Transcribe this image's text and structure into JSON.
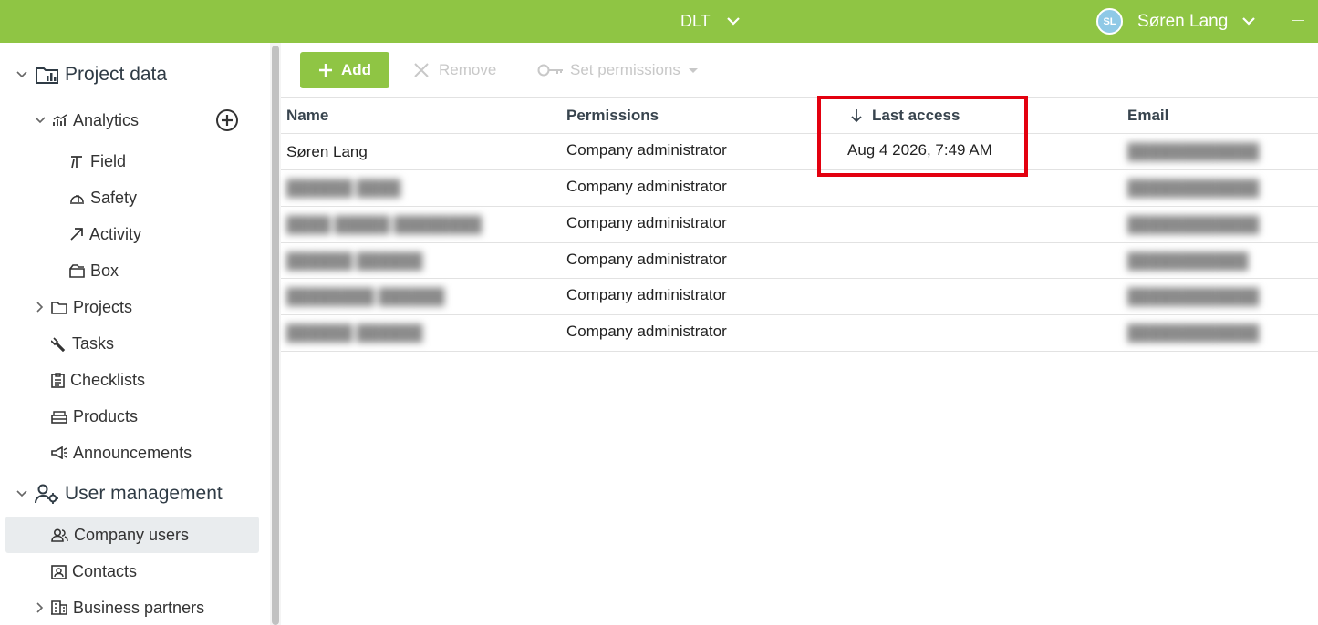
{
  "topbar": {
    "org_name": "DLT",
    "user_initials": "SL",
    "user_name": "Søren Lang",
    "accent_color": "#8fc544"
  },
  "sidebar": {
    "project_data": "Project data",
    "analytics": "Analytics",
    "analytics_children": [
      "Field",
      "Safety",
      "Activity",
      "Box"
    ],
    "items": [
      "Projects",
      "Tasks",
      "Checklists",
      "Products",
      "Announcements"
    ],
    "user_management": "User management",
    "um_items": [
      "Company users",
      "Contacts",
      "Business partners"
    ],
    "selected": "Company users"
  },
  "toolbar": {
    "add_label": "Add",
    "remove_label": "Remove",
    "permissions_label": "Set permissions"
  },
  "table": {
    "columns": [
      "Name",
      "Permissions",
      "Last access",
      "Email"
    ],
    "sort_column": "Last access",
    "sort_direction": "descending",
    "rows": [
      {
        "name": "Søren Lang",
        "permissions": "Company administrator",
        "last_access": "Aug 4 2026, 7:49 AM",
        "email": "████████████"
      },
      {
        "name": "██████ ████",
        "permissions": "Company administrator",
        "last_access": "",
        "email": "████████████"
      },
      {
        "name": "████ █████ ████████",
        "permissions": "Company administrator",
        "last_access": "",
        "email": "████████████"
      },
      {
        "name": "██████ ██████",
        "permissions": "Company administrator",
        "last_access": "",
        "email": "███████████"
      },
      {
        "name": "████████ ██████",
        "permissions": "Company administrator",
        "last_access": "",
        "email": "████████████"
      },
      {
        "name": "██████ ██████",
        "permissions": "Company administrator",
        "last_access": "",
        "email": "████████████"
      }
    ]
  },
  "highlight_color": "#e3000f"
}
